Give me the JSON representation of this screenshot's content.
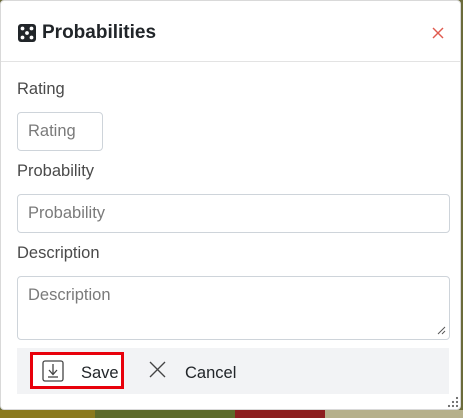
{
  "dialog": {
    "title": "Probabilities",
    "title_icon": "dice-icon",
    "close_icon": "close-icon"
  },
  "form": {
    "rating": {
      "label": "Rating",
      "placeholder": "Rating",
      "value": ""
    },
    "probability": {
      "label": "Probability",
      "placeholder": "Probability",
      "value": ""
    },
    "description": {
      "label": "Description",
      "placeholder": "Description",
      "value": ""
    }
  },
  "footer": {
    "save_label": "Save",
    "save_icon": "download-icon",
    "cancel_label": "Cancel",
    "cancel_icon": "close-icon"
  },
  "colors": {
    "highlight": "#e8000b",
    "close": "#e05a4f",
    "footer_bg": "#f2f3f5"
  }
}
